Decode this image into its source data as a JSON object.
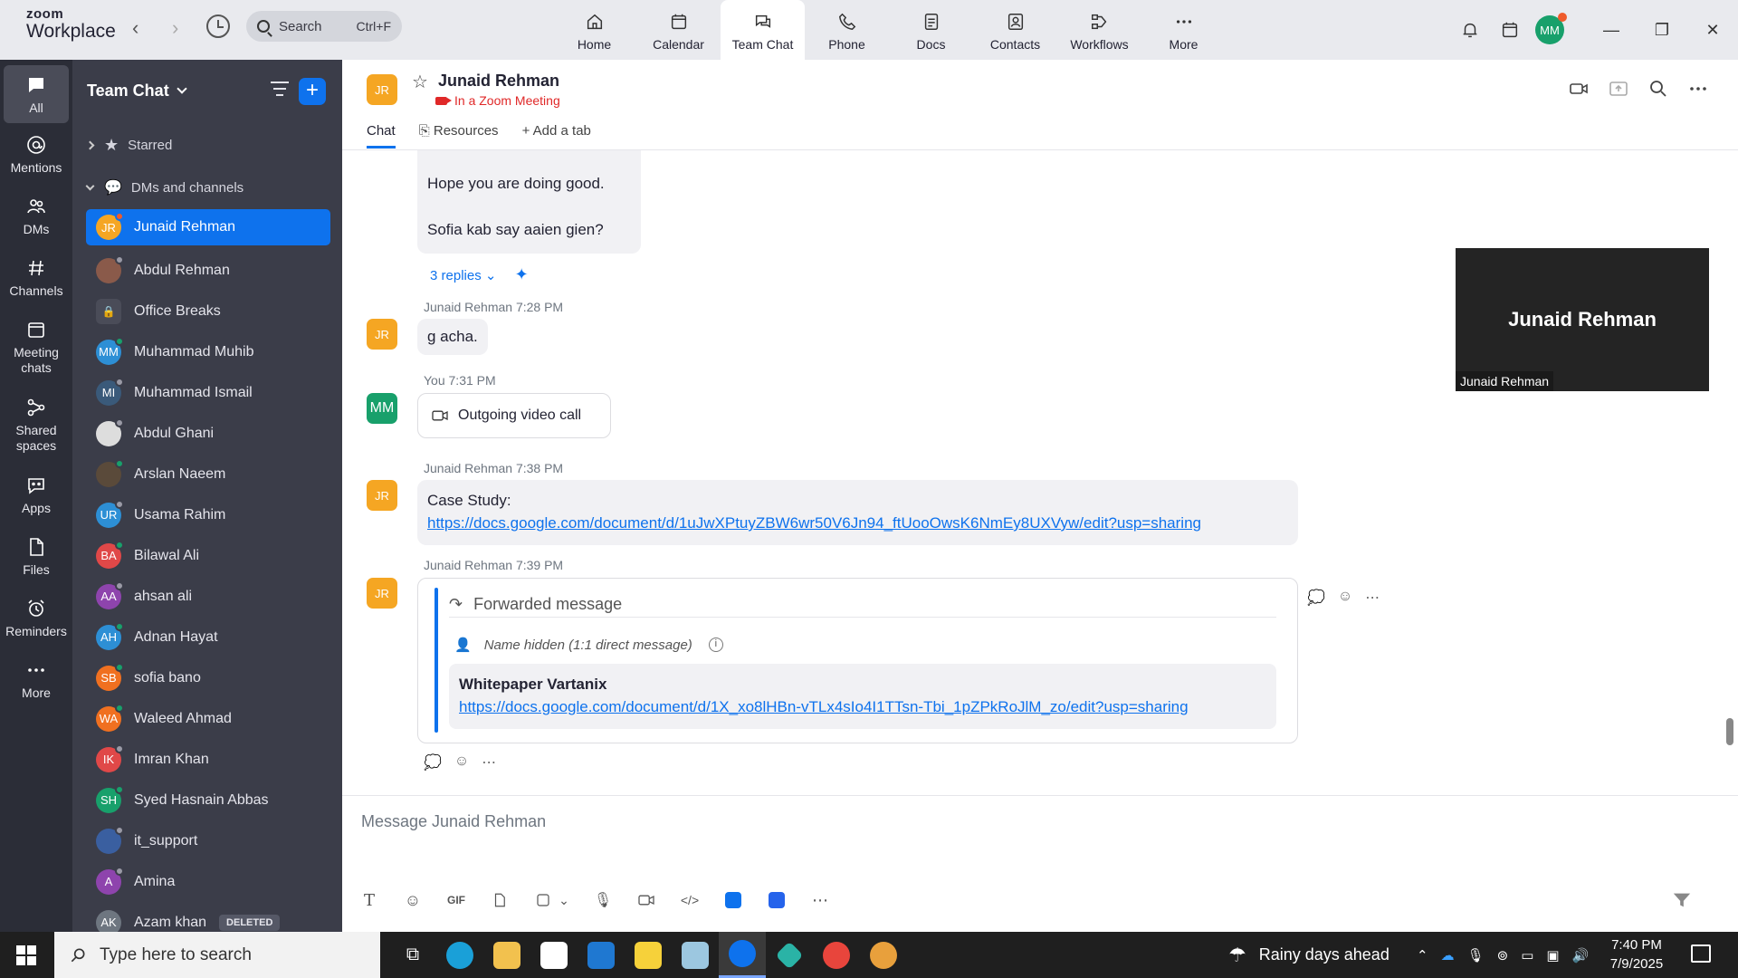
{
  "app": {
    "logo_top": "zoom",
    "logo_bottom": "Workplace"
  },
  "search": {
    "label": "Search",
    "shortcut": "Ctrl+F"
  },
  "nav_tabs": [
    {
      "label": "Home"
    },
    {
      "label": "Calendar"
    },
    {
      "label": "Team Chat"
    },
    {
      "label": "Phone"
    },
    {
      "label": "Docs"
    },
    {
      "label": "Contacts"
    },
    {
      "label": "Workflows"
    },
    {
      "label": "More"
    }
  ],
  "user_avatar": "MM",
  "rail": [
    {
      "label": "All"
    },
    {
      "label": "Mentions"
    },
    {
      "label": "DMs"
    },
    {
      "label": "Channels"
    },
    {
      "label": "Meeting chats"
    },
    {
      "label": "Shared spaces"
    },
    {
      "label": "Apps"
    },
    {
      "label": "Files"
    },
    {
      "label": "Reminders"
    },
    {
      "label": "More"
    }
  ],
  "sidebar": {
    "title": "Team Chat",
    "starred": "Starred",
    "dms_section": "DMs and channels",
    "items": [
      {
        "initials": "JR",
        "name": "Junaid Rehman",
        "color": "#f5a623",
        "status": "#ef5b2b"
      },
      {
        "initials": "",
        "name": "Abdul Rehman",
        "color": "#8a5a4a",
        "status": "#9a9aa6"
      },
      {
        "initials": "",
        "name": "Office Breaks",
        "color": "#4a4c58",
        "status": ""
      },
      {
        "initials": "MM",
        "name": "Muhammad Muhib",
        "color": "#2d8fd5",
        "status": "#18a06b"
      },
      {
        "initials": "MI",
        "name": "Muhammad Ismail",
        "color": "#3a5a7a",
        "status": "#9a9aa6"
      },
      {
        "initials": "",
        "name": "Abdul Ghani",
        "color": "#dddddd",
        "status": "#9a9aa6"
      },
      {
        "initials": "",
        "name": "Arslan Naeem",
        "color": "#5a4a3a",
        "status": "#18a06b"
      },
      {
        "initials": "UR",
        "name": "Usama Rahim",
        "color": "#2d8fd5",
        "status": "#9a9aa6"
      },
      {
        "initials": "BA",
        "name": "Bilawal Ali",
        "color": "#e04848",
        "status": "#18a06b"
      },
      {
        "initials": "AA",
        "name": "ahsan ali",
        "color": "#8e44ad",
        "status": "#9a9aa6"
      },
      {
        "initials": "AH",
        "name": "Adnan Hayat",
        "color": "#2d8fd5",
        "status": "#18a06b"
      },
      {
        "initials": "SB",
        "name": "sofia bano",
        "color": "#f07020",
        "status": "#18a06b"
      },
      {
        "initials": "WA",
        "name": "Waleed Ahmad",
        "color": "#f07020",
        "status": "#18a06b"
      },
      {
        "initials": "IK",
        "name": "Imran Khan",
        "color": "#e04848",
        "status": "#9a9aa6"
      },
      {
        "initials": "SH",
        "name": "Syed Hasnain Abbas",
        "color": "#18a06b",
        "status": "#18a06b"
      },
      {
        "initials": "",
        "name": "it_support",
        "color": "#3a5fa0",
        "status": "#9a9aa6"
      },
      {
        "initials": "A",
        "name": "Amina",
        "color": "#8e44ad",
        "status": "#9a9aa6"
      },
      {
        "initials": "AK",
        "name": "Azam khan",
        "color": "#6e7680",
        "status": "",
        "badge": "DELETED"
      }
    ]
  },
  "chat": {
    "contact_initials": "JR",
    "contact_name": "Junaid Rehman",
    "contact_status": "In a Zoom Meeting",
    "tabs": {
      "chat": "Chat",
      "resources": "Resources",
      "add": "Add a tab"
    },
    "msg1_line1": "Hope you are doing good.",
    "msg1_line2": "Sofia kab say aaien gien?",
    "replies": "3 replies",
    "msg2_meta": "Junaid Rehman 7:28 PM",
    "msg2_text": "g acha.",
    "msg3_meta": "You 7:31 PM",
    "msg3_initials": "MM",
    "msg3_text": "Outgoing video call",
    "msg4_meta": "Junaid Rehman 7:38 PM",
    "msg4_text": "Case Study:",
    "msg4_link": "https://docs.google.com/document/d/1uJwXPtuyZBW6wr50V6Jn94_ftUooOwsK6NmEy8UXVyw/edit?usp=sharing",
    "msg5_meta": "Junaid Rehman 7:39 PM",
    "fwd_label": "Forwarded message",
    "fwd_source": "Name hidden (1:1 direct message)",
    "fwd_title": "Whitepaper Vartanix",
    "fwd_link": "https://docs.google.com/document/d/1X_xo8lHBn-vTLx4sIo4I1TTsn-Tbi_1pZPkRoJlM_zo/edit?usp=sharing",
    "video_name_big": "Junaid Rehman",
    "video_name_small": "Junaid Rehman",
    "composer_placeholder": "Message Junaid Rehman"
  },
  "taskbar": {
    "search_placeholder": "Type here to search",
    "weather": "Rainy days ahead",
    "time": "7:40 PM",
    "date": "7/9/2025"
  }
}
